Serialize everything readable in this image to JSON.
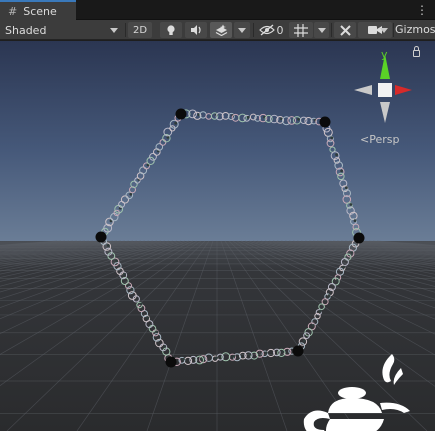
{
  "tabs": [
    {
      "label": "Scene"
    }
  ],
  "toolbar": {
    "shading_mode": "Shaded",
    "mode_2d_label": "2D",
    "hidden_count": "0",
    "gizmos_label": "Gizmos"
  },
  "gizmo": {
    "axis_y_label": "y",
    "projection_label": "Persp"
  },
  "colors": {
    "sky_top": "#2b3652",
    "sky_horizon": "#6a7d96",
    "ground": "#2a2b2d",
    "axis_y": "#5ad127",
    "axis_x": "#d62a2a",
    "axis_neutral": "#c9c9c9"
  },
  "scene_objects": {
    "vertex_markers": 6,
    "shape": "hexagon path of particles",
    "logo": "lamp-logo"
  }
}
